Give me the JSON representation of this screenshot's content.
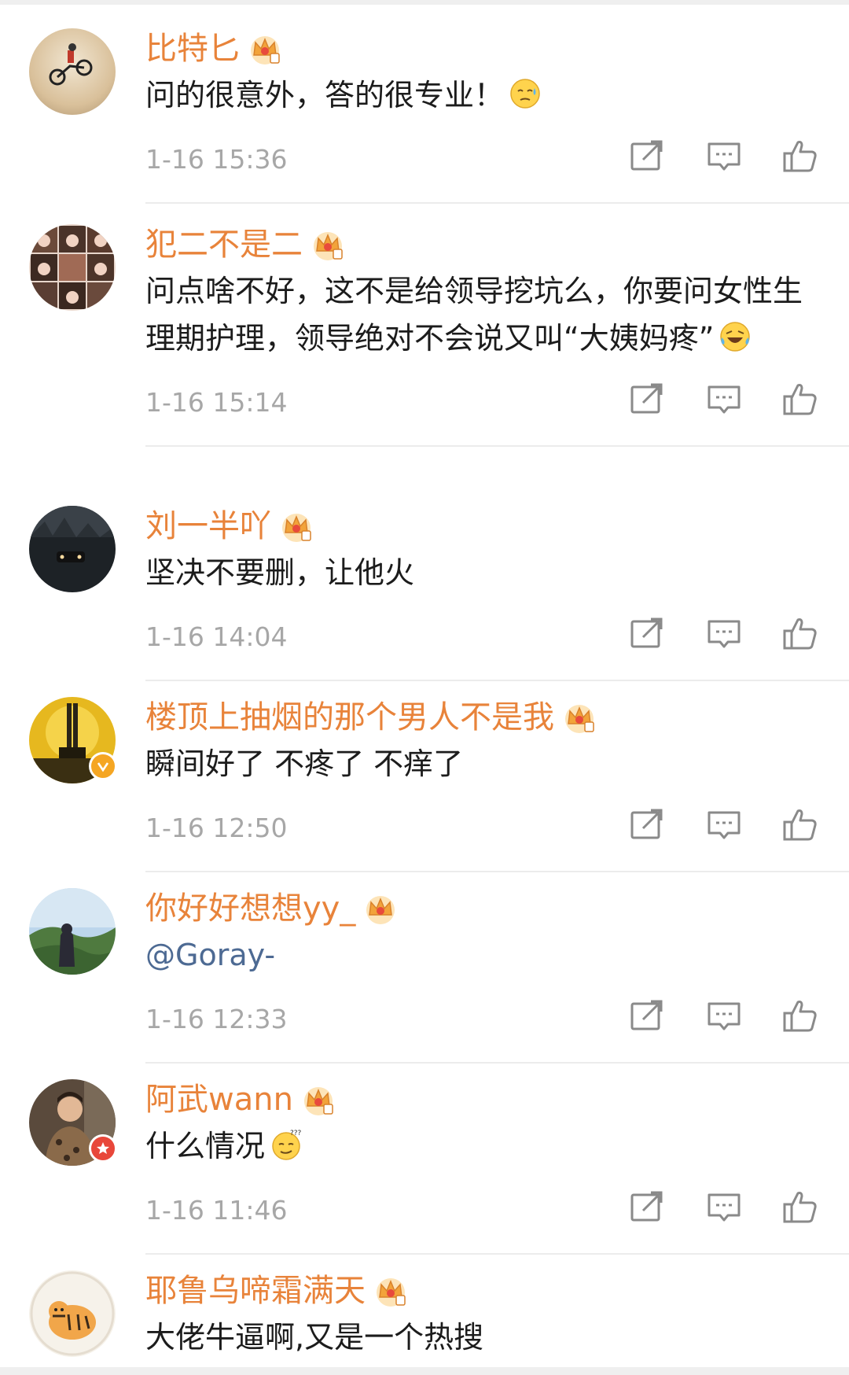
{
  "colors": {
    "username": "#e8833a",
    "body_text": "#1c1c1c",
    "timestamp": "#a7a7a7",
    "mention": "#4d6a93",
    "divider": "#ececec",
    "verified_badge": "#f5a623",
    "star_badge": "#e8473a"
  },
  "icons": {
    "crown": "crown-vip-icon",
    "share": "share-icon",
    "reply": "reply-icon",
    "like": "like-icon"
  },
  "comments": [
    {
      "username": "比特匕",
      "text": "问的很意外，答的很专业！",
      "emoji": "sweat-emoji",
      "time": "1-16 15:36",
      "avatar": "bmx-rider-avatar"
    },
    {
      "username": "犯二不是二",
      "text": "问点啥不好，这不是给领导挖坑么，你要问女性生理期护理，领导绝对不会说又叫“大姨妈疼”",
      "emoji": "laugh-cry-emoji",
      "time": "1-16 15:14",
      "avatar": "photo-grid-avatar"
    },
    {
      "username": "刘一半吖",
      "text": "坚决不要删，让他火",
      "emoji": "",
      "time": "1-16 14:04",
      "avatar": "night-car-avatar"
    },
    {
      "username": "楼顶上抽烟的那个男人不是我",
      "text": "瞬间好了 不疼了 不痒了",
      "emoji": "",
      "time": "1-16 12:50",
      "avatar": "sunset-avatar",
      "badge": "verified-badge-icon"
    },
    {
      "username": "你好好想想yy_",
      "text": "@Goray-",
      "emoji": "",
      "time": "1-16 12:33",
      "avatar": "landscape-avatar"
    },
    {
      "username": "阿武wann",
      "text": "什么情况",
      "emoji": "confused-emoji",
      "time": "1-16 11:46",
      "avatar": "man-portrait-avatar",
      "badge": "star-badge-icon"
    },
    {
      "username": "耶鲁乌啼霜满天",
      "text": "大佬牛逼啊,又是一个热搜",
      "emoji": "",
      "time": "",
      "avatar": "tiger-cartoon-avatar"
    }
  ]
}
